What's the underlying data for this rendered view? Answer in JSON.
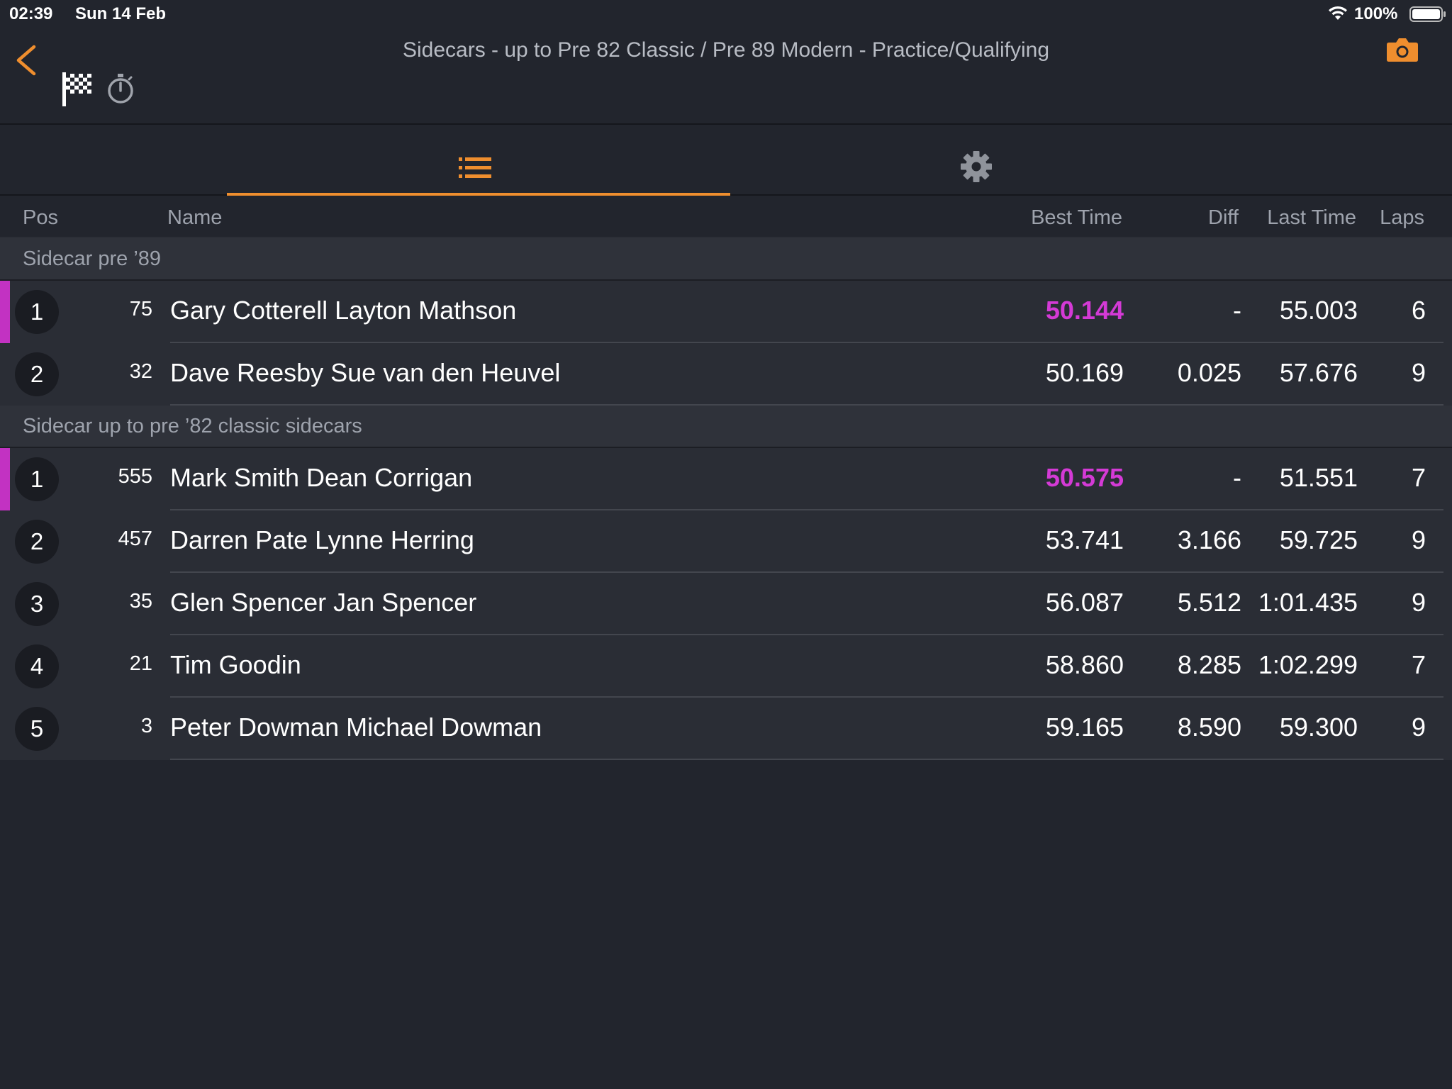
{
  "status_bar": {
    "time": "02:39",
    "date": "Sun 14 Feb",
    "battery_percent": "100%"
  },
  "header": {
    "title": "Sidecars - up to Pre 82 Classic / Pre 89 Modern - Practice/Qualifying",
    "icons": [
      "back-chevron-icon",
      "checkered-flag-icon",
      "stopwatch-icon",
      "camera-icon"
    ]
  },
  "tabs": [
    {
      "icon": "list-icon",
      "active": true
    },
    {
      "icon": "gear-icon",
      "active": false
    }
  ],
  "columns": {
    "pos": "Pos",
    "name": "Name",
    "best_time": "Best Time",
    "diff": "Diff",
    "last_time": "Last Time",
    "laps": "Laps"
  },
  "groups": [
    {
      "title": "Sidecar pre ’89",
      "rows": [
        {
          "pos": "1",
          "num": "75",
          "name": "Gary Cotterell Layton Mathson",
          "best": "50.144",
          "diff": "-",
          "last": "55.003",
          "laps": "6",
          "leader": true
        },
        {
          "pos": "2",
          "num": "32",
          "name": "Dave Reesby Sue van den Heuvel",
          "best": "50.169",
          "diff": "0.025",
          "last": "57.676",
          "laps": "9",
          "leader": false
        }
      ]
    },
    {
      "title": "Sidecar up to pre ’82 classic sidecars",
      "rows": [
        {
          "pos": "1",
          "num": "555",
          "name": "Mark Smith Dean Corrigan",
          "best": "50.575",
          "diff": "-",
          "last": "51.551",
          "laps": "7",
          "leader": true
        },
        {
          "pos": "2",
          "num": "457",
          "name": "Darren Pate Lynne Herring",
          "best": "53.741",
          "diff": "3.166",
          "last": "59.725",
          "laps": "9",
          "leader": false
        },
        {
          "pos": "3",
          "num": "35",
          "name": "Glen Spencer Jan Spencer",
          "best": "56.087",
          "diff": "5.512",
          "last": "1:01.435",
          "laps": "9",
          "leader": false
        },
        {
          "pos": "4",
          "num": "21",
          "name": "Tim Goodin",
          "best": "58.860",
          "diff": "8.285",
          "last": "1:02.299",
          "laps": "7",
          "leader": false
        },
        {
          "pos": "5",
          "num": "3",
          "name": "Peter Dowman Michael Dowman",
          "best": "59.165",
          "diff": "8.590",
          "last": "59.300",
          "laps": "9",
          "leader": false
        }
      ]
    }
  ],
  "colors": {
    "background": "#22252d",
    "accent": "#ef8e2e",
    "fastest": "#d43ad6"
  }
}
